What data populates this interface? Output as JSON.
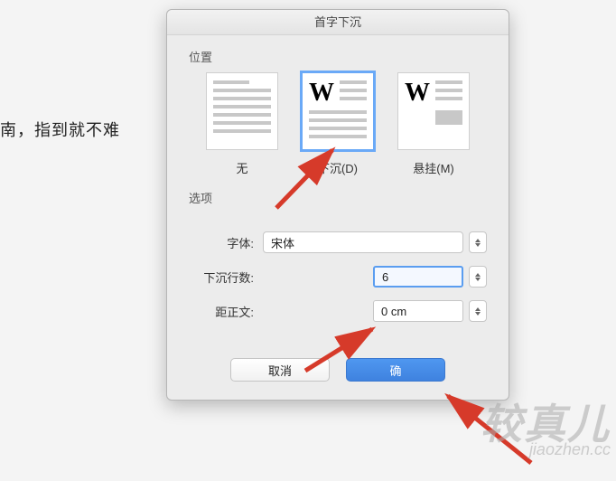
{
  "doc_text": "南，指到就不难",
  "dialog": {
    "title": "首字下沉",
    "section_position": "位置",
    "positions": {
      "none": "无",
      "drop": "下沉(D)",
      "hanging": "悬挂(M)"
    },
    "section_options": "选项",
    "font_label": "字体:",
    "font_value": "宋体",
    "lines_label": "下沉行数:",
    "lines_value": "6",
    "distance_label": "距正文:",
    "distance_value": "0 cm",
    "cancel": "取消",
    "ok": "确"
  },
  "watermark": {
    "cn": "较真儿",
    "py": "jiaozhen.cc"
  }
}
